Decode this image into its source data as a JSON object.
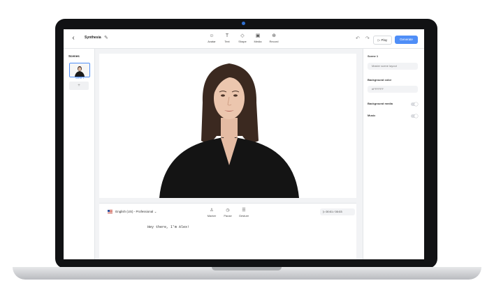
{
  "header": {
    "back_icon": "arrow-left-icon",
    "title": "Synthesia",
    "tools": [
      {
        "label": "Avatar",
        "icon": "avatar-icon"
      },
      {
        "label": "Text",
        "icon": "text-icon"
      },
      {
        "label": "Shape",
        "icon": "shape-icon"
      },
      {
        "label": "Media",
        "icon": "media-icon"
      },
      {
        "label": "Record",
        "icon": "record-icon"
      }
    ],
    "play_label": "Play",
    "generate_label": "Generate"
  },
  "scenes": {
    "title": "Scenes",
    "items": [
      {
        "label": "Scene 1"
      }
    ],
    "add_label": "+"
  },
  "script": {
    "language": "English (US) - Professional",
    "tools": [
      {
        "label": "Marker",
        "icon": "marker-icon"
      },
      {
        "label": "Pause",
        "icon": "pause-icon"
      },
      {
        "label": "Gesture",
        "icon": "gesture-icon"
      }
    ],
    "duration": "00:01 / 00:03",
    "text": "Hey there, I'm Alex!"
  },
  "properties": {
    "scene_label": "Scene 1",
    "layout_value": "Master scene layout",
    "background_color_label": "Background color",
    "background_color_value": "#FFFFFF",
    "background_media_label": "Background media",
    "music_label": "Music"
  },
  "colors": {
    "accent": "#4f8ef7",
    "lid": "#111214"
  }
}
